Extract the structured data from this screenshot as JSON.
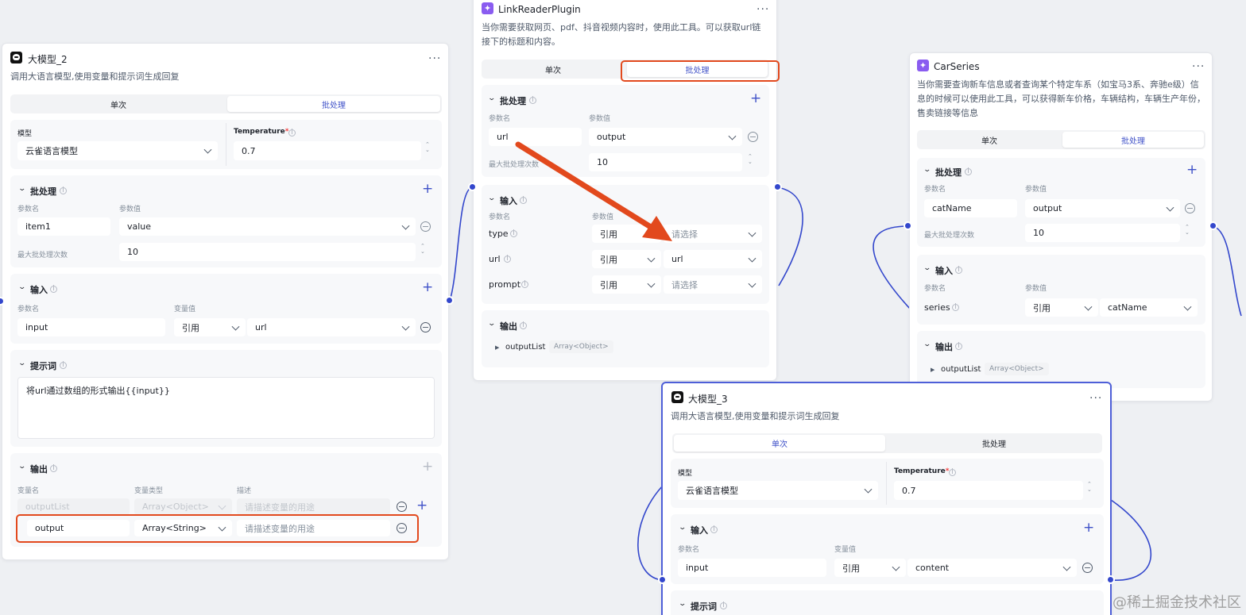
{
  "node_llm2": {
    "title": "大模型_2",
    "more": "···",
    "description": "调用大语言模型,使用变量和提示词生成回复",
    "tabs": [
      "单次",
      "批处理"
    ],
    "model_label": "模型",
    "model_value": "云雀语言模型",
    "temperature_label": "Temperature",
    "required_mark": "*",
    "temperature_value": "0.7",
    "batch": {
      "title": "批处理",
      "param_name_label": "参数名",
      "param_value_label": "参数值",
      "param_name": "item1",
      "param_value": "value",
      "max_label": "最大批处理次数",
      "max_value": "10"
    },
    "input": {
      "title": "输入",
      "param_name_label": "参数名",
      "var_value_label": "变量值",
      "name": "input",
      "ref": "引用",
      "value": "url"
    },
    "prompt": {
      "title": "提示词",
      "text": "将url通过数组的形式输出{{input}}"
    },
    "output": {
      "title": "输出",
      "col_name": "变量名",
      "col_type": "变量类型",
      "col_desc": "描述",
      "rows": [
        {
          "name": "outputList",
          "type": "Array<Object>",
          "desc_placeholder": "请描述变量的用途"
        },
        {
          "name": "output",
          "type": "Array<String>",
          "desc_placeholder": "请描述变量的用途"
        }
      ]
    }
  },
  "node_link": {
    "title": "LinkReaderPlugin",
    "more": "···",
    "description": "当你需要获取网页、pdf、抖音视频内容时，使用此工具。可以获取url链接下的标题和内容。",
    "tabs": [
      "单次",
      "批处理"
    ],
    "batch": {
      "title": "批处理",
      "param_name_label": "参数名",
      "param_value_label": "参数值",
      "param_name": "url",
      "param_value": "output",
      "max_label": "最大批处理次数",
      "max_value": "10"
    },
    "input": {
      "title": "输入",
      "param_name_label": "参数名",
      "param_value_label": "参数值",
      "rows": [
        {
          "name": "type",
          "ref": "引用",
          "value": "请选择"
        },
        {
          "name": "url",
          "ref": "引用",
          "value": "url"
        },
        {
          "name": "prompt",
          "ref": "引用",
          "value": "请选择"
        }
      ]
    },
    "output": {
      "title": "输出",
      "name": "outputList",
      "type": "Array<Object>"
    }
  },
  "node_car": {
    "title": "CarSeries",
    "more": "···",
    "description": "当你需要查询新车信息或者查询某个特定车系（如宝马3系、奔驰e级）信息的时候可以使用此工具，可以获得新车价格，车辆结构，车辆生产年份，售卖链接等信息",
    "tabs": [
      "单次",
      "批处理"
    ],
    "batch": {
      "title": "批处理",
      "param_name_label": "参数名",
      "param_value_label": "参数值",
      "param_name": "catName",
      "param_value": "output",
      "max_label": "最大批处理次数",
      "max_value": "10"
    },
    "input": {
      "title": "输入",
      "param_name_label": "参数名",
      "param_value_label": "参数值",
      "name": "series",
      "ref": "引用",
      "value": "catName"
    },
    "output": {
      "title": "输出",
      "name": "outputList",
      "type": "Array<Object>"
    }
  },
  "node_llm3": {
    "title": "大模型_3",
    "more": "···",
    "description": "调用大语言模型,使用变量和提示词生成回复",
    "tabs": [
      "单次",
      "批处理"
    ],
    "model_label": "模型",
    "model_value": "云雀语言模型",
    "temperature_label": "Temperature",
    "required_mark": "*",
    "temperature_value": "0.7",
    "input": {
      "title": "输入",
      "param_name_label": "参数名",
      "var_value_label": "变量值",
      "name": "input",
      "ref": "引用",
      "value": "content"
    },
    "prompt": {
      "title": "提示词"
    }
  },
  "watermark": "@稀土掘金技术社区",
  "colors": {
    "accent": "#3f51c8",
    "port": "#3347cc",
    "annotation": "#e2491d",
    "selected_border": "#4e5fd8"
  }
}
